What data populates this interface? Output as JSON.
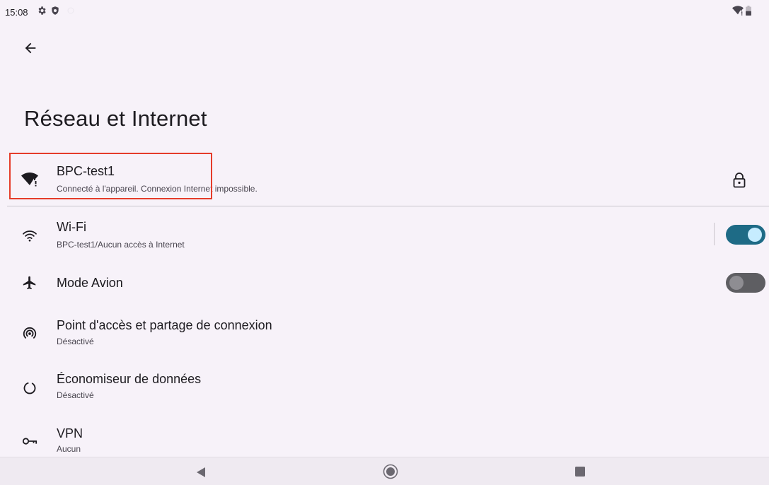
{
  "status_bar": {
    "time": "15:08",
    "icons": [
      "gear-icon",
      "shield-icon",
      "circle-dot-icon",
      "wifi-alert-icon",
      "battery-icon"
    ]
  },
  "header": {
    "back_icon": "arrow-back-icon",
    "title": "Réseau et Internet"
  },
  "current_network": {
    "name": "BPC-test1",
    "status": "Connecté à l'appareil. Connexion Internet impossible.",
    "icon": "wifi-alert-icon",
    "trailing_icon": "lock-icon",
    "highlight_color": "#e53c2a"
  },
  "items": [
    {
      "id": "wifi",
      "title": "Wi-Fi",
      "subtitle": "BPC-test1/Aucun accès à Internet",
      "icon": "wifi-icon",
      "toggle": true,
      "toggle_on": true
    },
    {
      "id": "airplane",
      "title": "Mode Avion",
      "subtitle": "",
      "icon": "airplane-icon",
      "toggle": true,
      "toggle_on": false
    },
    {
      "id": "hotspot",
      "title": "Point d'accès et partage de connexion",
      "subtitle": "Désactivé",
      "icon": "hotspot-icon",
      "toggle": false
    },
    {
      "id": "data-saver",
      "title": "Économiseur de données",
      "subtitle": "Désactivé",
      "icon": "data-saver-icon",
      "toggle": false
    },
    {
      "id": "vpn",
      "title": "VPN",
      "subtitle": "Aucun",
      "icon": "vpn-key-icon",
      "toggle": false
    }
  ],
  "nav_bar": {
    "icons": [
      "nav-back-icon",
      "nav-home-icon",
      "nav-recents-icon"
    ]
  },
  "colors": {
    "background": "#f7f2f9",
    "toggle_on_track": "#1e6b86",
    "toggle_on_knob": "#c6ecff",
    "toggle_off_track": "#5e5e62",
    "toggle_off_knob": "#8e8d92"
  }
}
